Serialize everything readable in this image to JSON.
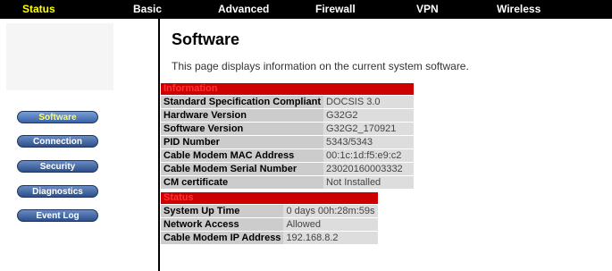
{
  "nav": {
    "status": "Status",
    "basic": "Basic",
    "advanced": "Advanced",
    "firewall": "Firewall",
    "vpn": "VPN",
    "wireless": "Wireless"
  },
  "sidebar": {
    "software": "Software",
    "connection": "Connection",
    "security": "Security",
    "diagnostics": "Diagnostics",
    "event_log": "Event Log"
  },
  "page": {
    "title": "Software",
    "description": "This page displays information on the current system software."
  },
  "information": {
    "header": "Information",
    "rows": [
      {
        "label": "Standard Specification Compliant",
        "value": "DOCSIS 3.0"
      },
      {
        "label": "Hardware Version",
        "value": "G32G2"
      },
      {
        "label": "Software Version",
        "value": "G32G2_170921"
      },
      {
        "label": "PID Number",
        "value": "5343/5343"
      },
      {
        "label": "Cable Modem MAC Address",
        "value": "00:1c:1d:f5:e9:c2"
      },
      {
        "label": "Cable Modem Serial Number",
        "value": "23020160003332"
      },
      {
        "label": "CM certificate",
        "value": "Not Installed"
      }
    ]
  },
  "status": {
    "header": "Status",
    "rows": [
      {
        "label": "System Up Time",
        "value": "0 days 00h:28m:59s"
      },
      {
        "label": "Network Access",
        "value": "Allowed"
      },
      {
        "label": "Cable Modem IP Address",
        "value": "192.168.8.2"
      }
    ]
  },
  "colors": {
    "nav_background": "#000000",
    "nav_active": "#ffff00",
    "section_header": "#cc0000",
    "sidebar_button": "#3b5fa0"
  }
}
